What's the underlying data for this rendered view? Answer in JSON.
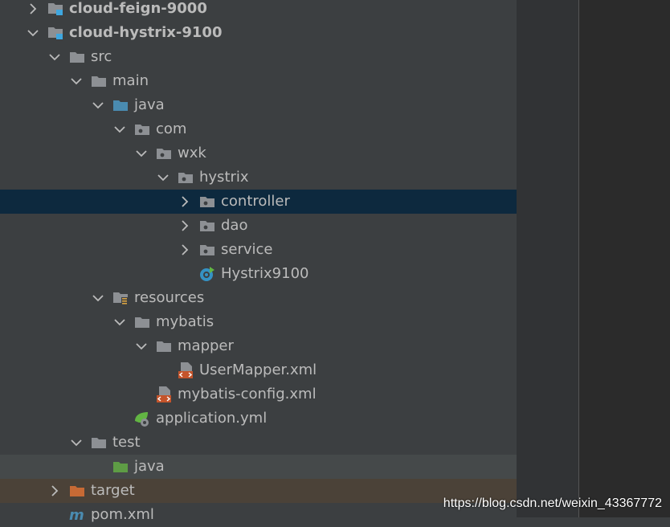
{
  "tree": {
    "items": [
      {
        "label": "cloud-feign-9000",
        "depth": 1,
        "expanded": false,
        "icon": "module-folder-icon",
        "bold": true,
        "state": ""
      },
      {
        "label": "cloud-hystrix-9100",
        "depth": 1,
        "expanded": true,
        "icon": "module-folder-icon",
        "bold": true,
        "state": ""
      },
      {
        "label": "src",
        "depth": 2,
        "expanded": true,
        "icon": "folder-icon",
        "bold": false,
        "state": ""
      },
      {
        "label": "main",
        "depth": 3,
        "expanded": true,
        "icon": "folder-icon",
        "bold": false,
        "state": ""
      },
      {
        "label": "java",
        "depth": 4,
        "expanded": true,
        "icon": "source-folder-icon",
        "bold": false,
        "state": ""
      },
      {
        "label": "com",
        "depth": 5,
        "expanded": true,
        "icon": "package-icon",
        "bold": false,
        "state": ""
      },
      {
        "label": "wxk",
        "depth": 6,
        "expanded": true,
        "icon": "package-icon",
        "bold": false,
        "state": ""
      },
      {
        "label": "hystrix",
        "depth": 7,
        "expanded": true,
        "icon": "package-icon",
        "bold": false,
        "state": ""
      },
      {
        "label": "controller",
        "depth": 8,
        "expanded": false,
        "icon": "package-icon",
        "bold": false,
        "state": "selected"
      },
      {
        "label": "dao",
        "depth": 8,
        "expanded": false,
        "icon": "package-icon",
        "bold": false,
        "state": ""
      },
      {
        "label": "service",
        "depth": 8,
        "expanded": false,
        "icon": "package-icon",
        "bold": false,
        "state": ""
      },
      {
        "label": "Hystrix9100",
        "depth": 8,
        "expanded": null,
        "icon": "spring-boot-class-icon",
        "bold": false,
        "state": ""
      },
      {
        "label": "resources",
        "depth": 4,
        "expanded": true,
        "icon": "resources-folder-icon",
        "bold": false,
        "state": ""
      },
      {
        "label": "mybatis",
        "depth": 5,
        "expanded": true,
        "icon": "folder-icon",
        "bold": false,
        "state": ""
      },
      {
        "label": "mapper",
        "depth": 6,
        "expanded": true,
        "icon": "folder-icon",
        "bold": false,
        "state": ""
      },
      {
        "label": "UserMapper.xml",
        "depth": 7,
        "expanded": null,
        "icon": "xml-file-icon",
        "bold": false,
        "state": ""
      },
      {
        "label": "mybatis-config.xml",
        "depth": 6,
        "expanded": null,
        "icon": "xml-file-icon",
        "bold": false,
        "state": ""
      },
      {
        "label": "application.yml",
        "depth": 5,
        "expanded": null,
        "icon": "spring-yml-icon",
        "bold": false,
        "state": ""
      },
      {
        "label": "test",
        "depth": 3,
        "expanded": true,
        "icon": "folder-icon",
        "bold": false,
        "state": ""
      },
      {
        "label": "java",
        "depth": 4,
        "expanded": null,
        "icon": "test-source-folder-icon",
        "bold": false,
        "state": "test-src"
      },
      {
        "label": "target",
        "depth": 2,
        "expanded": false,
        "icon": "excluded-folder-icon",
        "bold": false,
        "state": "excluded"
      },
      {
        "label": "pom.xml",
        "depth": 2,
        "expanded": null,
        "icon": "maven-icon",
        "bold": false,
        "state": ""
      }
    ]
  },
  "watermark": "https://blog.csdn.net/weixin_43367772",
  "colors": {
    "tree_bg": "#3c3f41",
    "text": "#bbbbbb",
    "selected_bg": "#0d293e",
    "folder": "#8d9094",
    "source_folder": "#4a8bb0",
    "test_folder": "#5e9c45",
    "excluded_folder": "#c76a35",
    "xml_orange": "#c4542b"
  }
}
